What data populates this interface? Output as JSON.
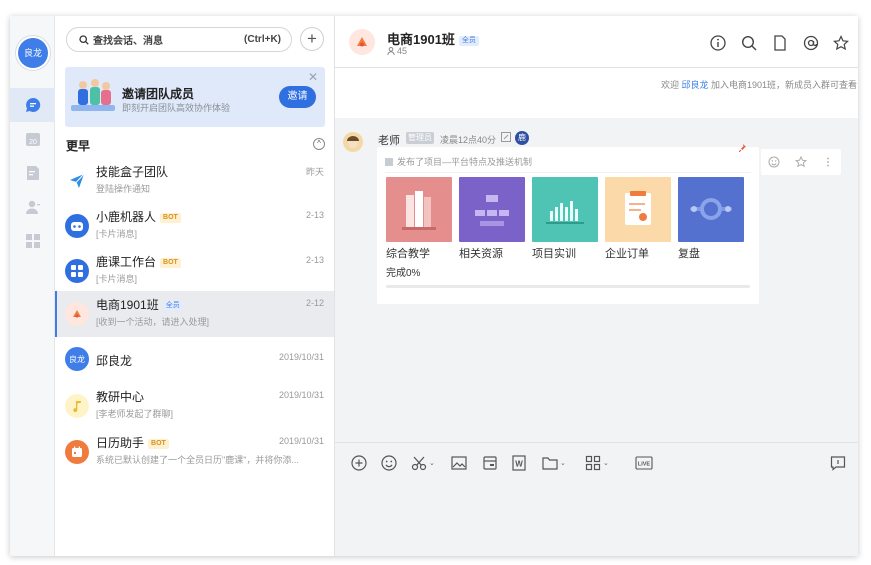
{
  "rail": {
    "avatar_text": "良龙",
    "items": [
      {
        "icon": "chat-bubble-icon",
        "active": true
      },
      {
        "icon": "calendar-icon",
        "label": "20",
        "active": false
      },
      {
        "icon": "document-edit-icon",
        "active": false
      },
      {
        "icon": "contacts-icon",
        "active": false
      },
      {
        "icon": "apps-grid-icon",
        "active": false
      }
    ]
  },
  "search": {
    "placeholder": "查找会话、消息",
    "shortcut": "(Ctrl+K)",
    "add_label": "+"
  },
  "invite": {
    "title": "邀请团队成员",
    "subtitle": "即刻开启团队高效协作体验",
    "button": "邀请",
    "close": "✕"
  },
  "section": {
    "label": "更早",
    "toggle": "^"
  },
  "conversations": [
    {
      "name": "技能盒子团队",
      "tag": "",
      "sub": "登陆操作通知",
      "time": "昨天",
      "icon": "send-icon",
      "color": "#ffffff",
      "selected": false
    },
    {
      "name": "小鹿机器人",
      "tag": "BOT",
      "sub": "[卡片消息]",
      "time": "2-13",
      "icon": "robot-icon",
      "color": "#2f6fe0",
      "selected": false
    },
    {
      "name": "鹿课工作台",
      "tag": "BOT",
      "sub": "[卡片消息]",
      "time": "2-13",
      "icon": "workbench-icon",
      "color": "#2f6fe0",
      "selected": false
    },
    {
      "name": "电商1901班",
      "tag": "全员",
      "sub": "[收到一个活动，请进入处理]",
      "time": "2-12",
      "icon": "group-avatar-icon",
      "color": "#ffe6de",
      "selected": true
    },
    {
      "name": "邱良龙",
      "tag": "",
      "sub": "",
      "time": "2019/10/31",
      "icon": "user-avatar-icon",
      "avatar_text": "良龙",
      "color": "#3f7ee8",
      "selected": false
    },
    {
      "name": "教研中心",
      "tag": "",
      "sub": "[李老师发起了群聊]",
      "time": "2019/10/31",
      "icon": "music-note-icon",
      "color": "#fff4c8",
      "selected": false
    },
    {
      "name": "日历助手",
      "tag": "BOT",
      "sub": "系统已默认创建了一个全员日历\"鹿课\"，并将你添...",
      "time": "2019/10/31",
      "icon": "calendar-bot-icon",
      "color": "#f07b3f",
      "selected": false
    }
  ],
  "chat": {
    "title": "电商1901班",
    "title_tag": "全员",
    "member_count": "45",
    "header_icons": [
      "info-icon",
      "search-icon",
      "file-icon",
      "at-icon",
      "star-icon"
    ],
    "notice": {
      "prefix": "欢迎 ",
      "name": "邱良龙",
      "suffix": " 加入电商1901班，新成员入群可查看"
    },
    "message": {
      "sender": "老师",
      "role": "管理员",
      "time": "凌晨12点40分",
      "reader_badge": "鹿",
      "card": {
        "header": "发布了项目—平台特点及推送机制",
        "tiles": [
          {
            "label": "综合教学",
            "color": "#e58e8e"
          },
          {
            "label": "相关资源",
            "color": "#7b62c9"
          },
          {
            "label": "项目实训",
            "color": "#4fc4b4"
          },
          {
            "label": "企业订单",
            "color": "#fbd9a8"
          },
          {
            "label": "复盘",
            "color": "#5571cf"
          }
        ],
        "progress_text": "完成0%",
        "progress": 0
      }
    },
    "toolbar": [
      "add-circle-icon",
      "emoji-icon",
      "scissors-icon",
      "image-icon",
      "card-icon",
      "word-file-icon",
      "folder-icon",
      "apps-icon",
      "live-icon",
      "feedback-icon"
    ],
    "toolbar_live_label": "LIVE",
    "toolbar_word_label": "W"
  },
  "colors": {
    "accent": "#3f7ee8",
    "bot_tag": "#d9901a",
    "selected_row": "#e9ebee"
  }
}
